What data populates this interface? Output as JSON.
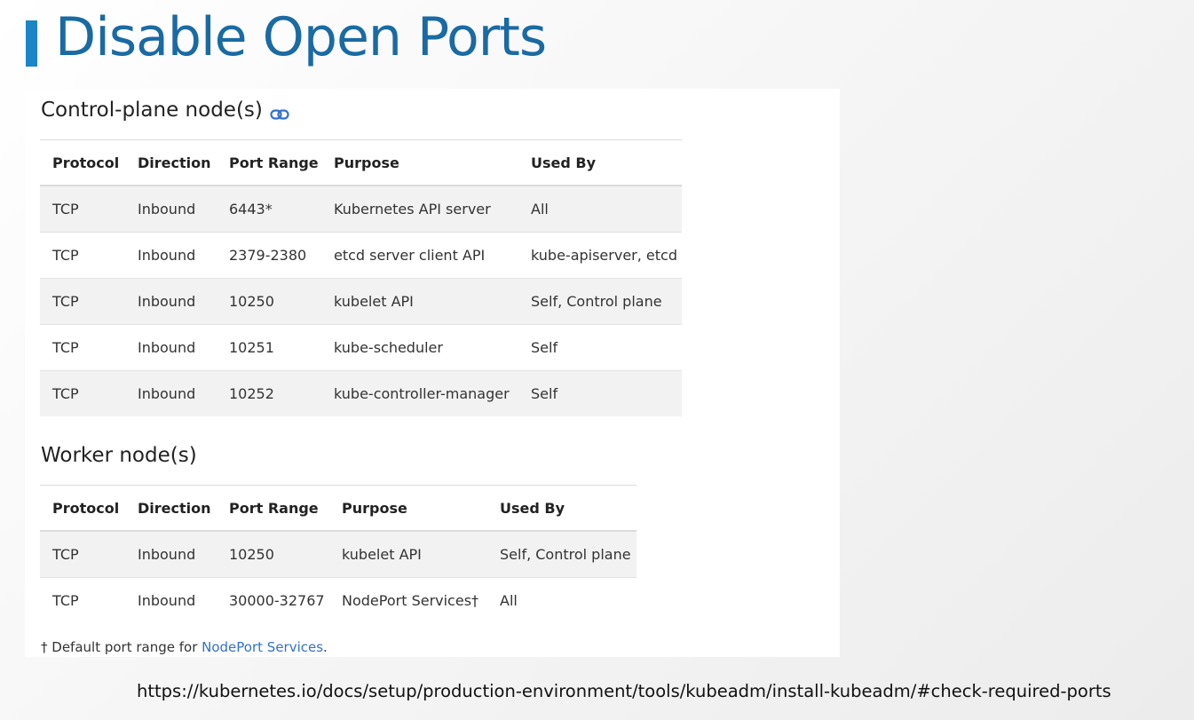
{
  "slide": {
    "title": "Disable Open Ports",
    "url": "https://kubernetes.io/docs/setup/production-environment/tools/kubeadm/install-kubeadm/#check-required-ports",
    "accent_color": "#1b85c8",
    "title_color": "#1a6aa3"
  },
  "control_plane": {
    "heading": "Control-plane node(s)",
    "icon": "link-icon",
    "headers": [
      "Protocol",
      "Direction",
      "Port Range",
      "Purpose",
      "Used By"
    ],
    "rows": [
      [
        "TCP",
        "Inbound",
        "6443*",
        "Kubernetes API server",
        "All"
      ],
      [
        "TCP",
        "Inbound",
        "2379-2380",
        "etcd server client API",
        "kube-apiserver, etcd"
      ],
      [
        "TCP",
        "Inbound",
        "10250",
        "kubelet API",
        "Self, Control plane"
      ],
      [
        "TCP",
        "Inbound",
        "10251",
        "kube-scheduler",
        "Self"
      ],
      [
        "TCP",
        "Inbound",
        "10252",
        "kube-controller-manager",
        "Self"
      ]
    ]
  },
  "worker": {
    "heading": "Worker node(s)",
    "headers": [
      "Protocol",
      "Direction",
      "Port Range",
      "Purpose",
      "Used By"
    ],
    "rows": [
      [
        "TCP",
        "Inbound",
        "10250",
        "kubelet API",
        "Self, Control plane"
      ],
      [
        "TCP",
        "Inbound",
        "30000-32767",
        "NodePort Services†",
        "All"
      ]
    ]
  },
  "footnote": {
    "prefix": "† Default port range for ",
    "link": "NodePort Services",
    "suffix": ".",
    "link_color": "#3371c8"
  }
}
